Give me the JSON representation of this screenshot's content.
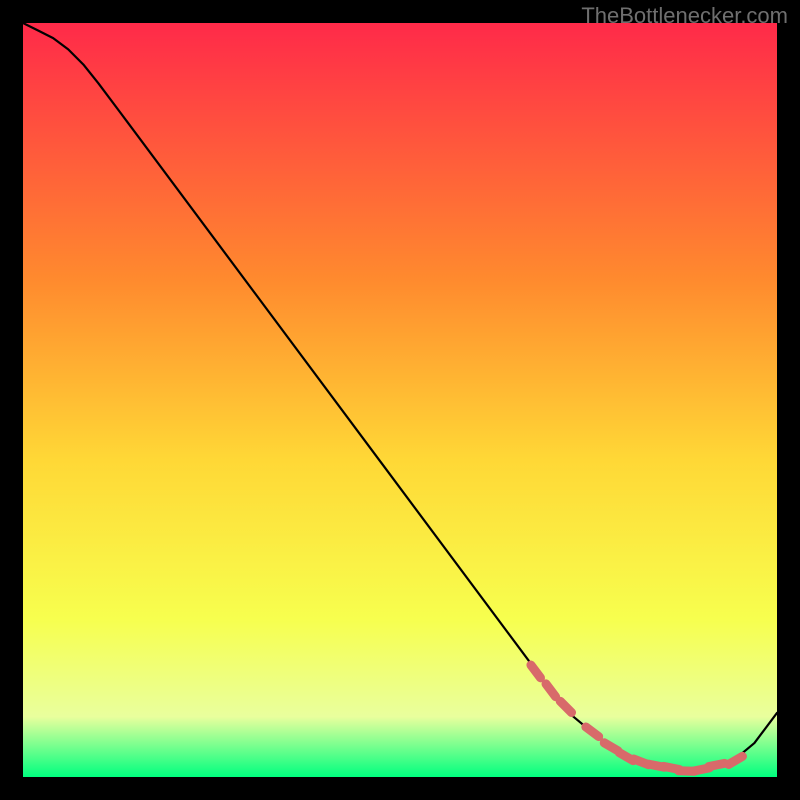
{
  "attribution": "TheBottlenecker.com",
  "colors": {
    "page_bg": "#000000",
    "attribution_text": "#6f6f6f",
    "gradient_top": "#ff2a49",
    "gradient_upper_mid": "#ff8a2e",
    "gradient_mid": "#ffd836",
    "gradient_lower_mid": "#f7ff4e",
    "gradient_low": "#e9ff9d",
    "gradient_bottom": "#00ff7f",
    "curve": "#000000",
    "marker_fill": "#d86a6a",
    "marker_stroke": "#c85858"
  },
  "chart_data": {
    "type": "line",
    "title": "",
    "xlabel": "",
    "ylabel": "",
    "xlim": [
      0,
      100
    ],
    "ylim": [
      0,
      100
    ],
    "grid": false,
    "series": [
      {
        "name": "bottleneck-curve",
        "x": [
          0,
          2,
          4,
          6,
          8,
          10,
          13,
          70,
          73,
          76,
          79,
          82,
          85,
          88,
          91,
          94,
          97,
          100
        ],
        "y": [
          100,
          99,
          98,
          96.5,
          94.5,
          92,
          88,
          11.5,
          8,
          5.5,
          3.5,
          2,
          1.2,
          0.8,
          1.0,
          2,
          4.5,
          8.5
        ]
      }
    ],
    "markers": [
      {
        "name": "highlighted-range-markers",
        "x": [
          68,
          70,
          72,
          75.5,
          78,
          80,
          82,
          84,
          86,
          88,
          90,
          92,
          94.5
        ],
        "y": [
          14,
          11.5,
          9.3,
          6,
          4,
          2.7,
          2,
          1.5,
          1.2,
          0.8,
          1.0,
          1.6,
          2.2
        ]
      }
    ]
  }
}
